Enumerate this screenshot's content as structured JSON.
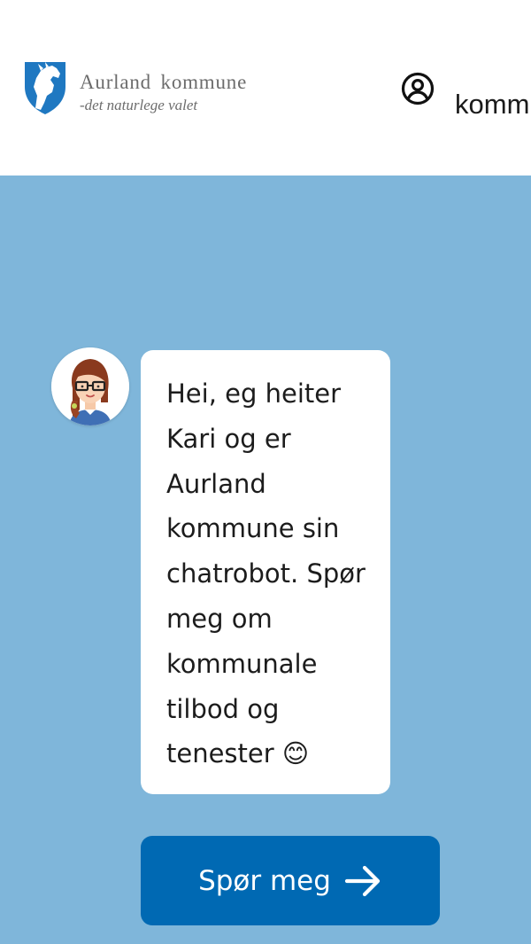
{
  "header": {
    "brand_name": "Aurland kommune",
    "brand_tagline": "-det naturlege valet",
    "nav_text": "kommune",
    "profile_icon": "user-circle-icon"
  },
  "chat": {
    "avatar_icon": "chatbot-avatar-kari",
    "message": "Hei, eg heiter Kari og er Aurland kommune sin chatrobot. Spør meg om kommunale tilbod og tenester 😊",
    "button_label": "Spør meg",
    "button_icon": "arrow-right-icon"
  },
  "colors": {
    "background": "#7fb6da",
    "header": "#ffffff",
    "button": "#0069b3",
    "crest_blue": "#1f78c1",
    "brand_text": "#6c6c6c"
  }
}
